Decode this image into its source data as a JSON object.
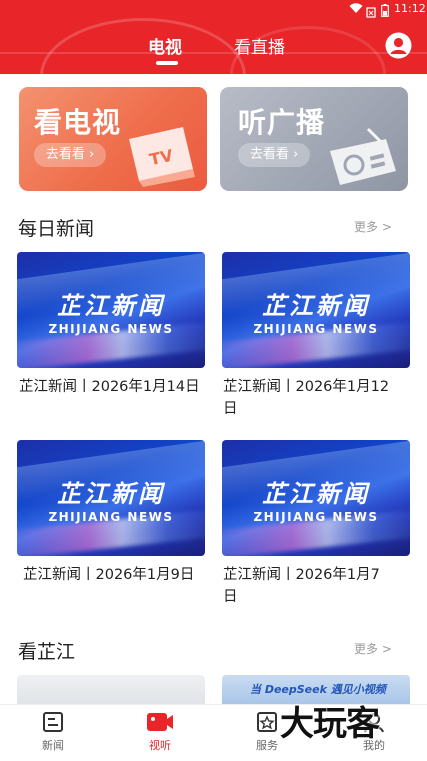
{
  "status_bar": {
    "time": "11:12"
  },
  "header": {
    "tabs": [
      {
        "label": "电视",
        "active": true
      },
      {
        "label": "看直播",
        "active": false
      }
    ]
  },
  "banners": [
    {
      "title": "看电视",
      "button": "去看看",
      "badge": "TV"
    },
    {
      "title": "听广播",
      "button": "去看看"
    }
  ],
  "daily_news": {
    "title": "每日新闻",
    "more": "更多 >",
    "items": [
      {
        "thumb_title": "芷江新闻",
        "thumb_subtitle": "ZHIJIANG NEWS",
        "caption": "芷江新闻丨2026年1月14日"
      },
      {
        "thumb_title": "芷江新闻",
        "thumb_subtitle": "ZHIJIANG NEWS",
        "caption": "芷江新闻丨2026年1月12日"
      },
      {
        "thumb_title": "芷江新闻",
        "thumb_subtitle": "ZHIJIANG NEWS",
        "caption": "芷江新闻丨2026年1月9日"
      },
      {
        "thumb_title": "芷江新闻",
        "thumb_subtitle": "ZHIJIANG NEWS",
        "caption": "芷江新闻丨2026年1月7日"
      }
    ]
  },
  "watch_zhijiang": {
    "title": "看芷江",
    "more": "更多 >",
    "preview_text": "当 DeepSeek 遇见小视频"
  },
  "bottom_nav": [
    {
      "label": "新闻",
      "icon": "news-icon",
      "active": false
    },
    {
      "label": "视听",
      "icon": "video-camera-icon",
      "active": true
    },
    {
      "label": "服务",
      "icon": "service-icon",
      "active": false
    },
    {
      "label": "我的",
      "icon": "profile-icon",
      "active": false
    }
  ],
  "watermark": "大玩客",
  "colors": {
    "brand_red": "#e8262a",
    "tv_orange": "#f0734f",
    "radio_gray": "#a4a9b6"
  }
}
